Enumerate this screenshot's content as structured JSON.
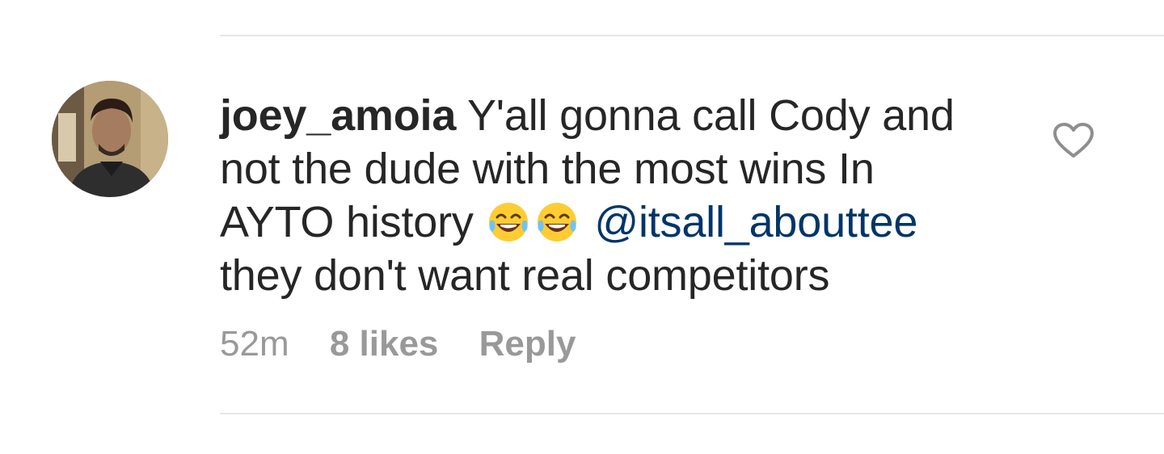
{
  "comment": {
    "username": "joey_amoia",
    "text_line_1": "Y'all gonna call Cody and not the dude with the most wins In AYTO history",
    "emojis": [
      "face-with-tears-of-joy-icon",
      "face-with-tears-of-joy-icon"
    ],
    "mention": "@itsall_abouttee",
    "text_line_2": "they don't want real competitors"
  },
  "meta": {
    "time": "52m",
    "likes": "8 likes",
    "reply": "Reply"
  },
  "icons": {
    "like": "heart-outline-icon"
  },
  "colors": {
    "text": "#262626",
    "mention": "#003569",
    "meta": "#999999",
    "divider": "#e6e6e6"
  }
}
